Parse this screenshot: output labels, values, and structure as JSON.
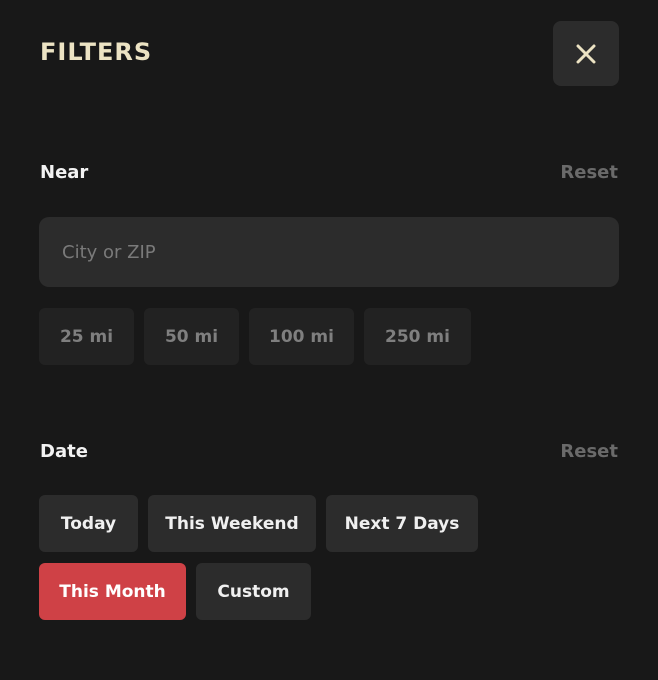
{
  "header": {
    "title": "FILTERS",
    "close_icon": "close-icon"
  },
  "near": {
    "label": "Near",
    "reset_label": "Reset",
    "input_placeholder": "City or ZIP",
    "input_value": "",
    "distance_options": [
      {
        "label": "25 mi",
        "selected": false
      },
      {
        "label": "50 mi",
        "selected": false
      },
      {
        "label": "100 mi",
        "selected": false
      },
      {
        "label": "250 mi",
        "selected": false
      }
    ]
  },
  "date": {
    "label": "Date",
    "reset_label": "Reset",
    "options": [
      {
        "label": "Today",
        "selected": false
      },
      {
        "label": "This Weekend",
        "selected": false
      },
      {
        "label": "Next 7 Days",
        "selected": false
      },
      {
        "label": "This Month",
        "selected": true
      },
      {
        "label": "Custom",
        "selected": false
      }
    ]
  },
  "colors": {
    "background": "#181818",
    "title": "#ece3c3",
    "accent": "#cf4146",
    "chip": "#2c2c2c",
    "muted": "#6a6a6a"
  }
}
